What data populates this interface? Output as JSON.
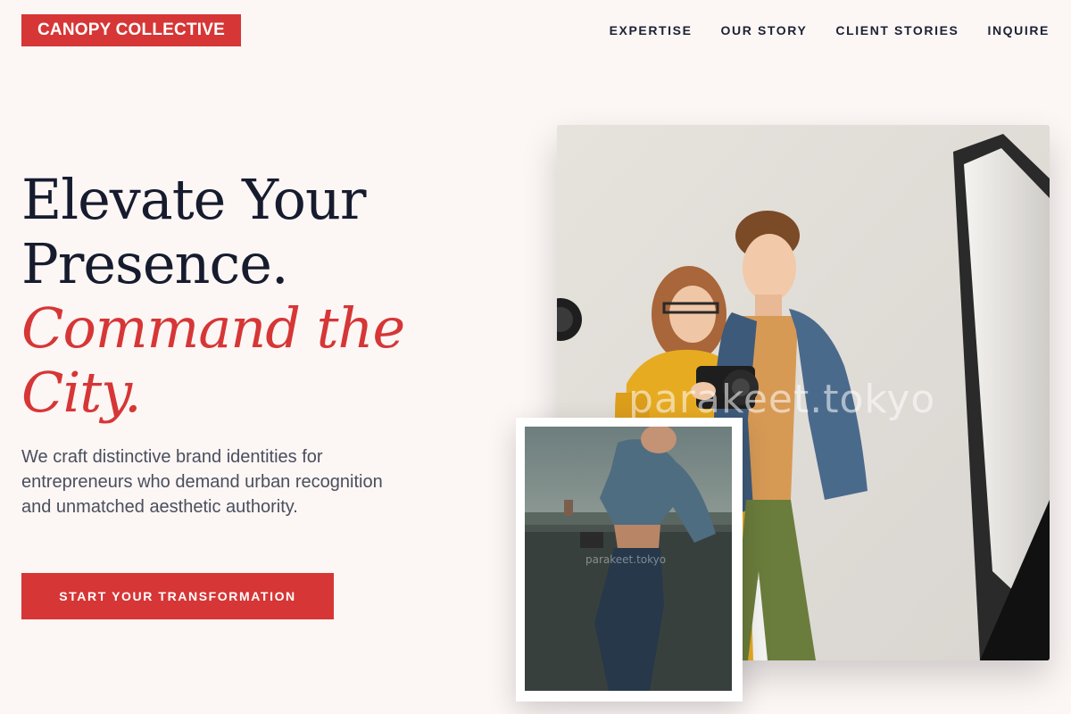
{
  "header": {
    "logo": "CANOPY COLLECTIVE",
    "nav": [
      "EXPERTISE",
      "OUR STORY",
      "CLIENT STORIES",
      "INQUIRE"
    ]
  },
  "hero": {
    "title_line1": "Elevate Your",
    "title_line2": "Presence.",
    "title_accent_line1": "Command the",
    "title_accent_line2": "City.",
    "subtitle": "We craft distinctive brand identities for entrepreneurs who demand urban recognition and unmatched aesthetic authority.",
    "cta_label": "START YOUR TRANSFORMATION"
  },
  "images": {
    "main_watermark": "parakeet.tokyo",
    "inset_watermark": "parakeet.tokyo"
  },
  "colors": {
    "accent": "#d63636",
    "background": "#fcf6f5",
    "heading": "#161c2e",
    "body_text": "#4a4f5c"
  }
}
